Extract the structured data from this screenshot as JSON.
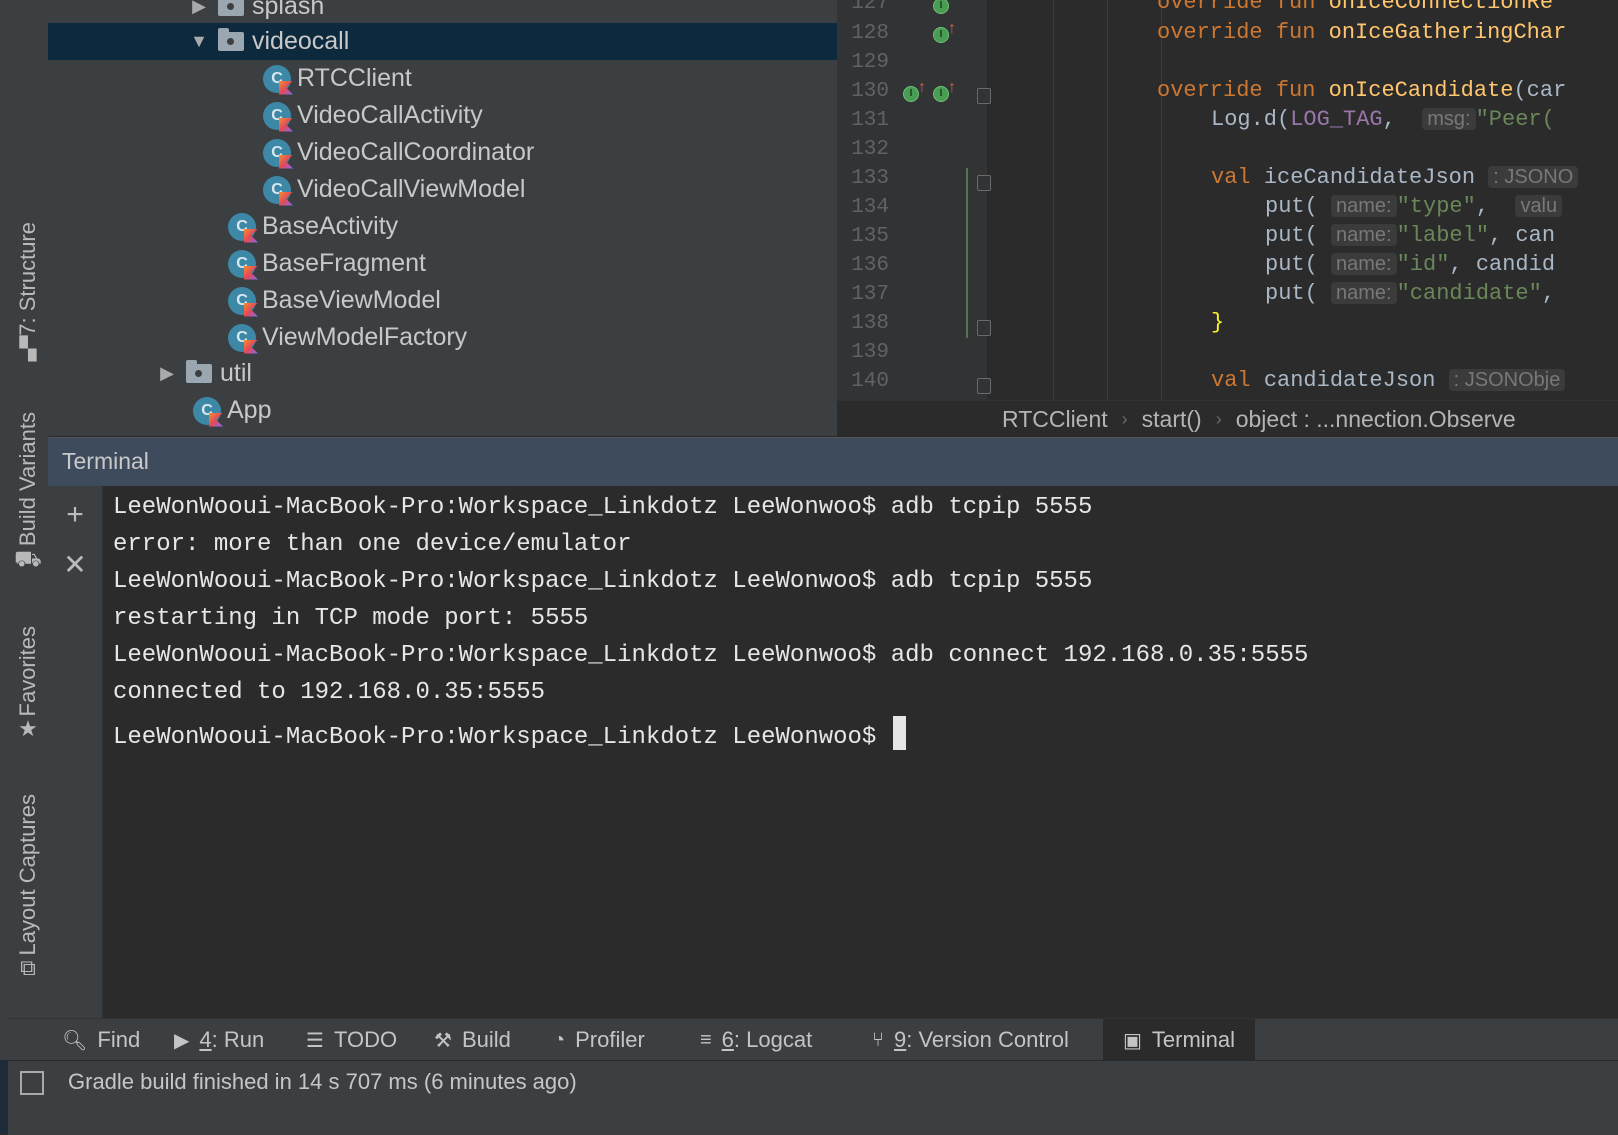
{
  "side_tabs": [
    {
      "label": "7: Structure",
      "icon": "structure-icon"
    },
    {
      "label": "Build Variants",
      "icon": "build-variants-icon"
    },
    {
      "label": "Favorites",
      "icon": "star-icon"
    },
    {
      "label": "Layout Captures",
      "icon": "layout-captures-icon"
    }
  ],
  "project_tree": [
    {
      "label": "splash",
      "type": "folder",
      "expanded": false
    },
    {
      "label": "videocall",
      "type": "folder",
      "expanded": true,
      "selected": true
    },
    {
      "label": "RTCClient",
      "type": "kotlin-class"
    },
    {
      "label": "VideoCallActivity",
      "type": "kotlin-class"
    },
    {
      "label": "VideoCallCoordinator",
      "type": "kotlin-class"
    },
    {
      "label": "VideoCallViewModel",
      "type": "kotlin-class"
    },
    {
      "label": "BaseActivity",
      "type": "kotlin-class"
    },
    {
      "label": "BaseFragment",
      "type": "kotlin-class"
    },
    {
      "label": "BaseViewModel",
      "type": "kotlin-class"
    },
    {
      "label": "ViewModelFactory",
      "type": "kotlin-class"
    },
    {
      "label": "util",
      "type": "folder",
      "expanded": false
    },
    {
      "label": "App",
      "type": "kotlin-class"
    }
  ],
  "editor": {
    "line_numbers": [
      "127",
      "128",
      "129",
      "130",
      "131",
      "132",
      "133",
      "134",
      "135",
      "136",
      "137",
      "138",
      "139",
      "140"
    ],
    "code": {
      "l127": {
        "kw": "override fun ",
        "fn": "onIceConnectionRe"
      },
      "l128": {
        "kw": "override fun ",
        "fn": "onIceGatheringChar"
      },
      "l130": {
        "kw": "override fun ",
        "fn": "onIceCandidate",
        "rest": "(car"
      },
      "l131": {
        "pre": "Log.d(",
        "const": "LOG_TAG",
        "mid": ", ",
        "hint": "msg:",
        "str": "\"Peer("
      },
      "l133": {
        "kw": "val ",
        "name": "iceCandidateJson",
        "hint": ": JSONO"
      },
      "l134": {
        "pre": "put(",
        "hint": "name:",
        "str": "\"type\"",
        "mid": ", ",
        "hint2": "valu"
      },
      "l135": {
        "pre": "put(",
        "hint": "name:",
        "str": "\"label\"",
        "rest": ", can"
      },
      "l136": {
        "pre": "put(",
        "hint": "name:",
        "str": "\"id\"",
        "rest": ", candid"
      },
      "l137": {
        "pre": "put(",
        "hint": "name:",
        "str": "\"candidate\"",
        "rest": ","
      },
      "l138": {
        "brace": "}"
      },
      "l140": {
        "kw": "val ",
        "name": "candidateJson",
        "hint": ": JSONObje"
      }
    }
  },
  "breadcrumb": [
    "RTCClient",
    "start()",
    "object : ...nnection.Observe"
  ],
  "terminal": {
    "title": "Terminal",
    "lines": [
      "LeeWonWooui-MacBook-Pro:Workspace_Linkdotz LeeWonwoo$ adb tcpip 5555",
      "error: more than one device/emulator",
      "LeeWonWooui-MacBook-Pro:Workspace_Linkdotz LeeWonwoo$ adb tcpip 5555",
      "restarting in TCP mode port: 5555",
      "LeeWonWooui-MacBook-Pro:Workspace_Linkdotz LeeWonwoo$ adb connect 192.168.0.35:5555",
      "connected to 192.168.0.35:5555",
      "LeeWonWooui-MacBook-Pro:Workspace_Linkdotz LeeWonwoo$ "
    ]
  },
  "tool_windows": [
    {
      "key": "",
      "label": "Find",
      "icon": "search-icon"
    },
    {
      "key": "4",
      "label": ": Run",
      "icon": "run-icon"
    },
    {
      "key": "",
      "label": "TODO",
      "icon": "todo-icon"
    },
    {
      "key": "",
      "label": "Build",
      "icon": "build-hammer-icon"
    },
    {
      "key": "",
      "label": "Profiler",
      "icon": "profiler-icon"
    },
    {
      "key": "6",
      "label": ": Logcat",
      "icon": "logcat-icon"
    },
    {
      "key": "9",
      "label": ": Version Control",
      "icon": "version-control-icon"
    },
    {
      "key": "",
      "label": "Terminal",
      "icon": "terminal-icon",
      "active": true
    }
  ],
  "status": {
    "text": "Gradle build finished in 14 s 707 ms (6 minutes ago)"
  },
  "colors": {
    "keyword": "#cc7832",
    "function": "#ffc66d",
    "string": "#6a8759",
    "constant": "#9876aa",
    "selection": "#0d293e"
  }
}
